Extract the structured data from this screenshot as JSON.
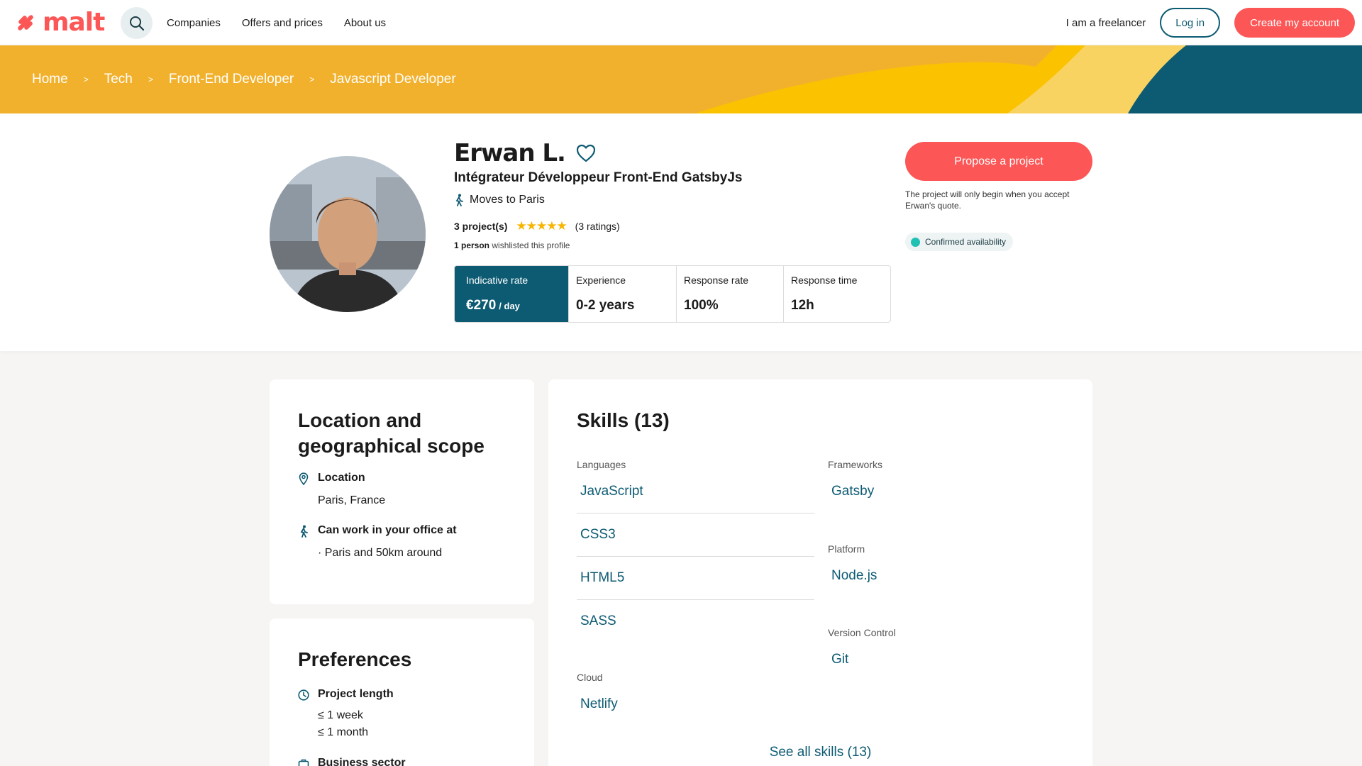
{
  "header": {
    "logo_text": "malt",
    "nav": [
      "Companies",
      "Offers and prices",
      "About us"
    ],
    "freelancer_link": "I am a freelancer",
    "login": "Log in",
    "signup": "Create my account"
  },
  "breadcrumb": [
    "Home",
    "Tech",
    "Front-End Developer",
    "Javascript Developer"
  ],
  "breadcrumb_separator": ">",
  "profile": {
    "name": "Erwan L.",
    "headline": "Intégrateur Développeur Front-End GatsbyJs",
    "moves": "Moves to Paris",
    "projects": "3 project(s)",
    "stars": "★★★★★",
    "ratings": "(3 ratings)",
    "wishlist_count": "1 person",
    "wishlist_text": "wishlisted this profile",
    "stats": {
      "rate_label": "Indicative rate",
      "rate_value": "€270",
      "rate_unit": "/ day",
      "experience_label": "Experience",
      "experience_value": "0-2 years",
      "response_rate_label": "Response rate",
      "response_rate_value": "100%",
      "response_time_label": "Response time",
      "response_time_value": "12h"
    },
    "propose_button": "Propose a project",
    "propose_note": "The project will only begin when you accept Erwan's quote.",
    "availability": "Confirmed availability"
  },
  "location_card": {
    "title_line1": "Location and",
    "title_line2": "geographical scope",
    "location_label": "Location",
    "location_value": "Paris, France",
    "office_label": "Can work in your office at",
    "office_value": "· Paris and 50km around"
  },
  "preferences_card": {
    "title": "Preferences",
    "project_length_label": "Project length",
    "project_length_values": [
      "≤ 1 week",
      "≤ 1 month"
    ],
    "business_sector_label": "Business sector"
  },
  "skills_card": {
    "title": "Skills (13)",
    "groups": {
      "languages": {
        "label": "Languages",
        "items": [
          "JavaScript",
          "CSS3",
          "HTML5",
          "SASS"
        ]
      },
      "cloud": {
        "label": "Cloud",
        "items": [
          "Netlify"
        ]
      },
      "frameworks": {
        "label": "Frameworks",
        "items": [
          "Gatsby"
        ]
      },
      "platform": {
        "label": "Platform",
        "items": [
          "Node.js"
        ]
      },
      "version_control": {
        "label": "Version Control",
        "items": [
          "Git"
        ]
      }
    },
    "see_all": "See all skills (13)"
  },
  "colors": {
    "brand": "#fc5656",
    "teal": "#0d5b73",
    "banner_yellow": "#f2b12c",
    "availability_dot": "#1fc1b3"
  }
}
